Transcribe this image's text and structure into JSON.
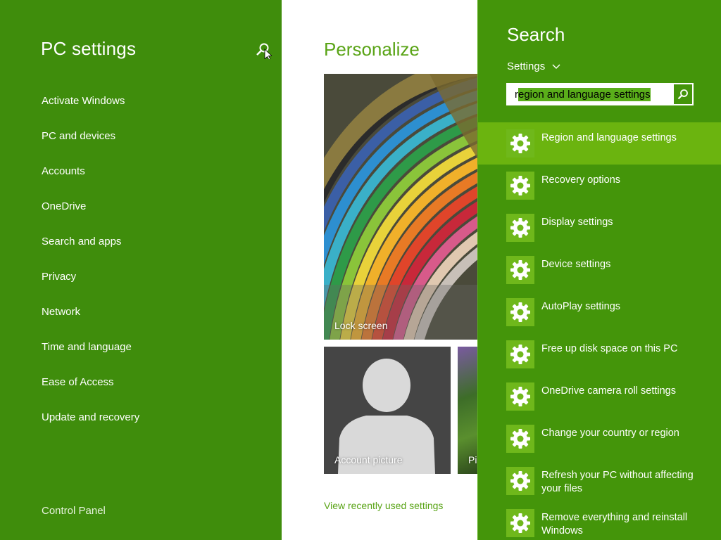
{
  "nav": {
    "title": "PC settings",
    "items": [
      {
        "label": "Activate Windows"
      },
      {
        "label": "PC and devices"
      },
      {
        "label": "Accounts"
      },
      {
        "label": "OneDrive"
      },
      {
        "label": "Search and apps"
      },
      {
        "label": "Privacy"
      },
      {
        "label": "Network"
      },
      {
        "label": "Time and language"
      },
      {
        "label": "Ease of Access"
      },
      {
        "label": "Update and recovery"
      }
    ],
    "control_panel": "Control Panel",
    "search_icon": "search-icon"
  },
  "content": {
    "title": "Personalize",
    "lock_screen_label": "Lock screen",
    "account_picture_label": "Account picture",
    "picture_label": "Pic",
    "recent_link": "View recently used settings"
  },
  "search": {
    "title": "Search",
    "scope": "Settings",
    "query_prefix": "r",
    "query_selected": "egion and language settings",
    "results": [
      {
        "label": "Region and language settings",
        "icon": "gear-icon",
        "selected": true
      },
      {
        "label": "Recovery options",
        "icon": "gear-icon"
      },
      {
        "label": "Display settings",
        "icon": "gear-icon"
      },
      {
        "label": "Device settings",
        "icon": "gear-icon"
      },
      {
        "label": "AutoPlay settings",
        "icon": "gear-icon"
      },
      {
        "label": "Free up disk space on this PC",
        "icon": "gear-icon"
      },
      {
        "label": "OneDrive camera roll settings",
        "icon": "gear-icon"
      },
      {
        "label": "Change your country or region",
        "icon": "gear-icon"
      },
      {
        "label": "Refresh your PC without affecting your files",
        "icon": "gear-icon"
      },
      {
        "label": "Remove everything and reinstall Windows",
        "icon": "gear-icon"
      }
    ]
  },
  "colors": {
    "nav_bg": "#3f8d0c",
    "search_bg": "#44950a",
    "accent": "#5aa417",
    "selected_result": "#6bb40f"
  }
}
